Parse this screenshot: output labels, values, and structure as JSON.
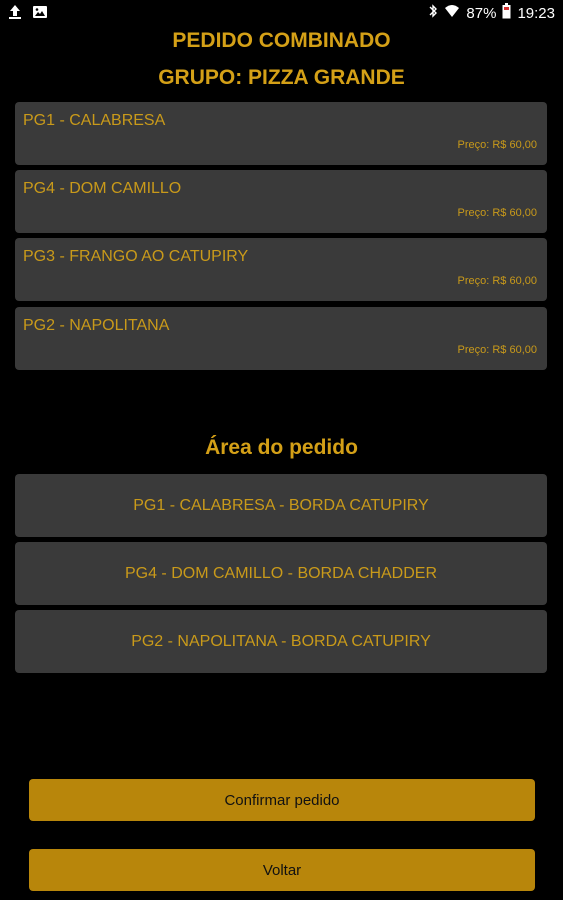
{
  "status_bar": {
    "battery": "87%",
    "time": "19:23"
  },
  "header": {
    "title": "PEDIDO COMBINADO",
    "group": "GRUPO: PIZZA GRANDE"
  },
  "products": [
    {
      "name": "PG1 - CALABRESA",
      "price": "Preço: R$ 60,00"
    },
    {
      "name": "PG4 - DOM CAMILLO",
      "price": "Preço: R$ 60,00"
    },
    {
      "name": "PG3 - FRANGO AO CATUPIRY",
      "price": "Preço: R$ 60,00"
    },
    {
      "name": "PG2 - NAPOLITANA",
      "price": "Preço: R$ 60,00"
    }
  ],
  "order_area": {
    "title": "Área do pedido",
    "items": [
      "PG1 - CALABRESA - BORDA CATUPIRY",
      "PG4 - DOM CAMILLO - BORDA CHADDER",
      "PG2 - NAPOLITANA - BORDA CATUPIRY"
    ]
  },
  "buttons": {
    "confirm": "Confirmar pedido",
    "back": "Voltar"
  },
  "colors": {
    "accent": "#d4a017",
    "card_bg": "#3a3a3a",
    "button_bg": "#b8860b"
  }
}
